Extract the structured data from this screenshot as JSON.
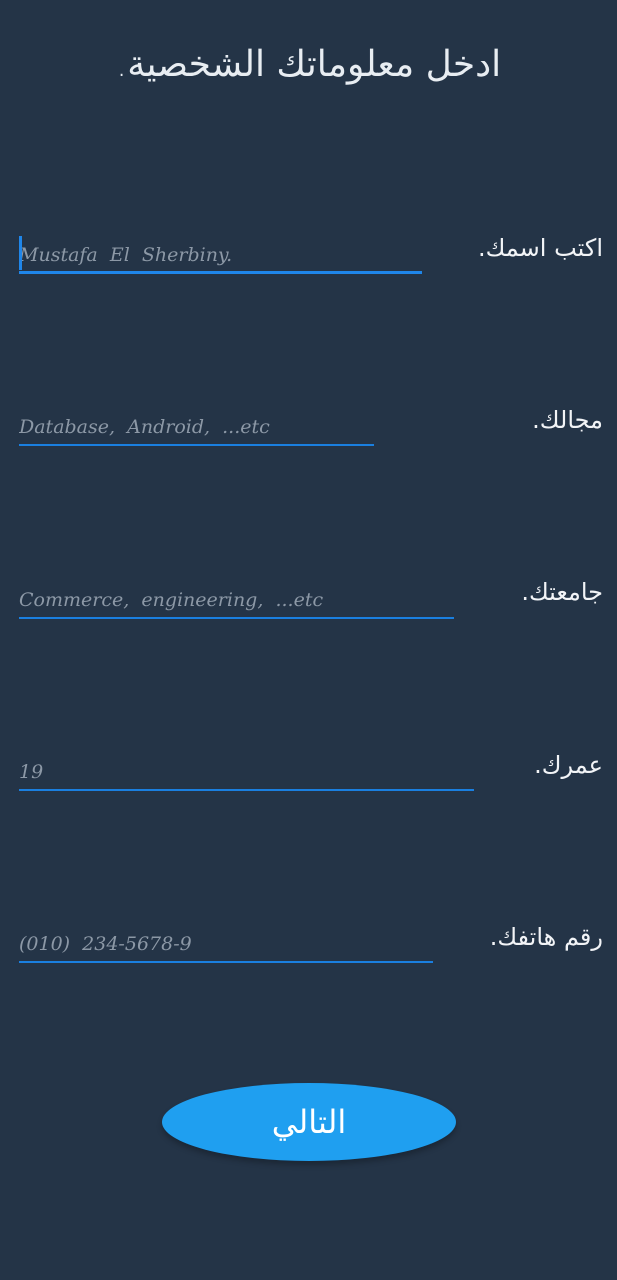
{
  "header": {
    "title": "ادخل معلوماتك الشخصية."
  },
  "form": {
    "fields": [
      {
        "label": "اكتب اسمك.",
        "placeholder": "Mustafa  El  Sherbiny.",
        "value": "",
        "focused": true
      },
      {
        "label": "مجالك.",
        "placeholder": "Database,  Android,  ...etc",
        "value": ""
      },
      {
        "label": "جامعتك.",
        "placeholder": "Commerce,  engineering,  ...etc",
        "value": ""
      },
      {
        "label": "عمرك.",
        "placeholder": "19",
        "value": ""
      },
      {
        "label": "رقم هاتفك.",
        "placeholder": "(010)  234-5678-9",
        "value": ""
      }
    ],
    "next_label": "التالي"
  },
  "colors": {
    "background": "#243447",
    "accent": "#1a7fe0",
    "button": "#1f9ff0"
  }
}
